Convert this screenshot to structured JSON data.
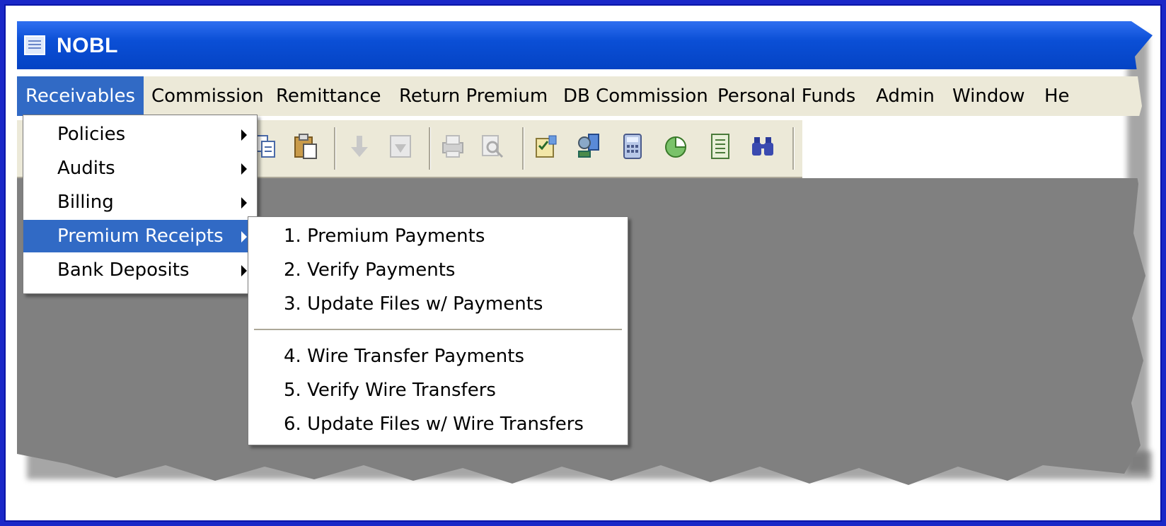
{
  "window": {
    "title": "NOBL"
  },
  "menubar": {
    "items": [
      {
        "label": "Receivables"
      },
      {
        "label": "Commission"
      },
      {
        "label": "Remittance"
      },
      {
        "label": "Return Premium"
      },
      {
        "label": "DB Commission"
      },
      {
        "label": "Personal Funds"
      },
      {
        "label": "Admin"
      },
      {
        "label": "Window"
      },
      {
        "label": "He"
      }
    ],
    "active_item": "Receivables"
  },
  "receivables_menu": {
    "items": [
      {
        "label": "Policies"
      },
      {
        "label": "Audits"
      },
      {
        "label": "Billing"
      },
      {
        "label": "Premium Receipts"
      },
      {
        "label": "Bank Deposits"
      }
    ],
    "selected": "Premium Receipts"
  },
  "premium_receipts_submenu": {
    "group1": [
      {
        "label": "1. Premium Payments"
      },
      {
        "label": "2. Verify Payments"
      },
      {
        "label": "3. Update Files w/ Payments"
      }
    ],
    "group2": [
      {
        "label": "4. Wire Transfer Payments"
      },
      {
        "label": "5. Verify Wire Transfers"
      },
      {
        "label": "6. Update Files w/ Wire Transfers"
      }
    ]
  },
  "toolbar": {
    "icons": [
      "copy-icon",
      "paste-icon",
      "move-down-icon",
      "import-icon",
      "print-icon",
      "print-preview-icon",
      "checklist-icon",
      "network-icon",
      "calculator-icon",
      "pie-chart-icon",
      "report-icon",
      "binoculars-icon"
    ]
  },
  "colors": {
    "border_blue": "#1a28c8",
    "titlebar_blue": "#0b4fd6",
    "menu_highlight": "#316ac5",
    "menubar_bg": "#ece9d8",
    "workspace_gray": "#808080"
  }
}
